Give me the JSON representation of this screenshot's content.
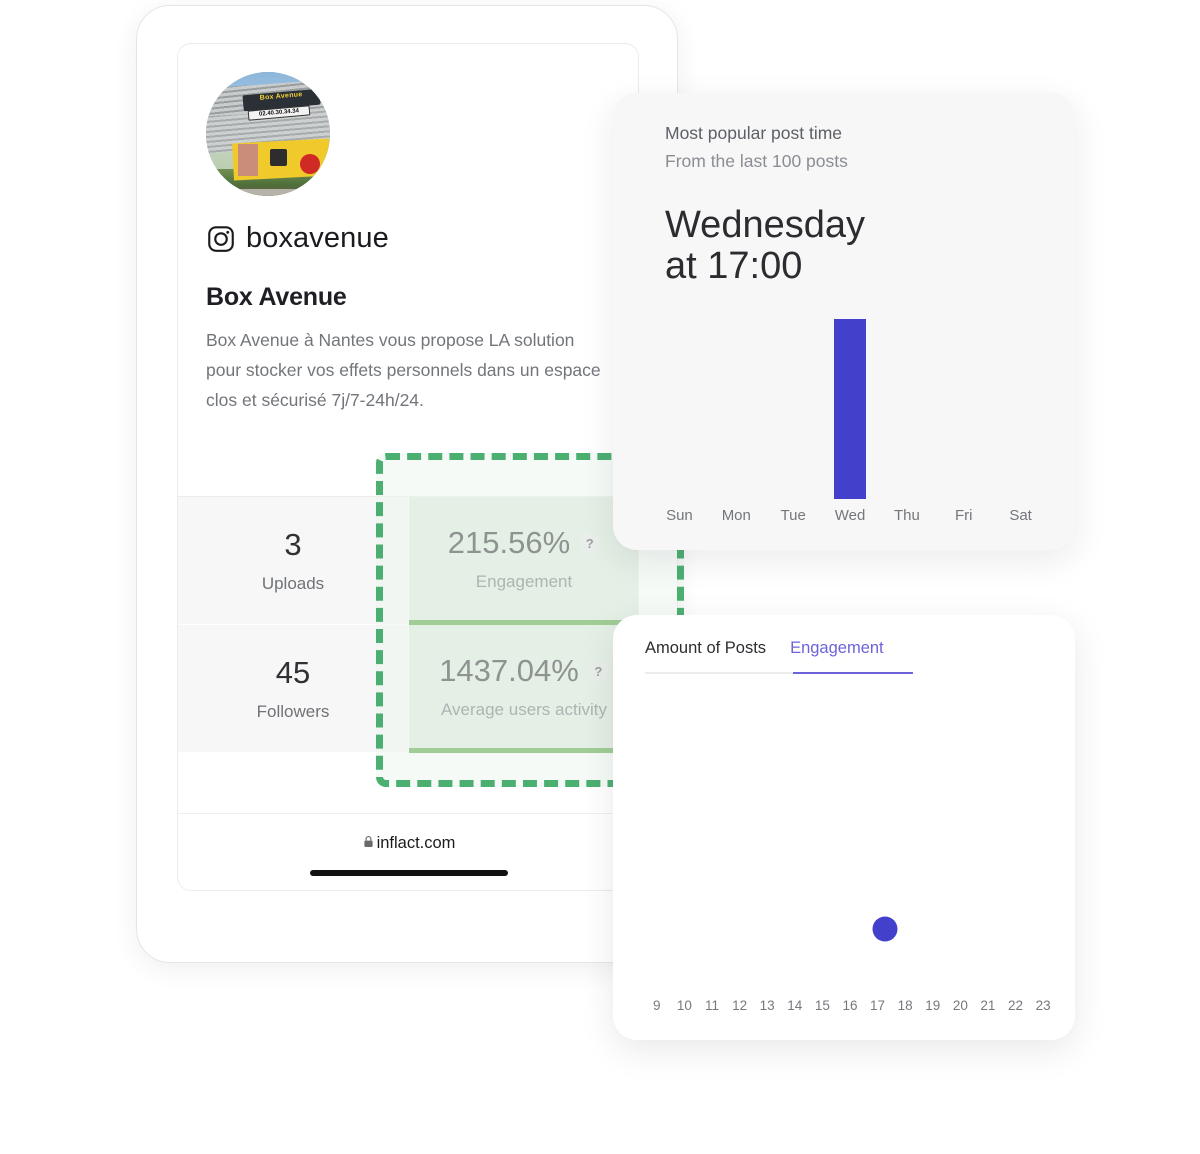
{
  "device": {
    "url": "inflact.com",
    "lock_icon": "lock-icon"
  },
  "profile": {
    "avatar_alt": "Box Avenue storefront photo",
    "platform_icon": "instagram-icon",
    "handle": "boxavenue",
    "full_name": "Box Avenue",
    "bio": "Box Avenue à Nantes vous propose LA solution pour stocker vos effets personnels dans un espace clos et sécurisé 7j/7-24h/24."
  },
  "stats": [
    {
      "value": "3",
      "label": "Uploads",
      "highlighted": false,
      "help": null
    },
    {
      "value": "215.56%",
      "label": "Engagement",
      "highlighted": true,
      "help": "?"
    },
    {
      "value": "45",
      "label": "Followers",
      "highlighted": false,
      "help": null
    },
    {
      "value": "1437.04%",
      "label": "Average users activity",
      "highlighted": true,
      "help": "?"
    }
  ],
  "device_tabs": {
    "items": [
      {
        "label": "Amount of Posts",
        "active": true
      },
      {
        "label": "Engagement",
        "active": false
      }
    ]
  },
  "post_time_card": {
    "title": "Most popular post time",
    "subtitle": "From the last 100 posts",
    "headline_line1": "Wednesday",
    "headline_line2": "at 17:00"
  },
  "engagement_card": {
    "tabs": [
      {
        "label": "Amount of Posts",
        "active": false
      },
      {
        "label": "Engagement",
        "active": true
      }
    ]
  },
  "colors": {
    "accent_purple": "#6c63d8",
    "bar_indigo": "#4340cc",
    "highlight_green": "#56a33c",
    "selection_green": "#4caf72",
    "highlight_bg": "#dde9dd"
  },
  "chart_data": [
    {
      "type": "bar",
      "title": "Most popular post time",
      "subtitle": "From the last 100 posts",
      "categories": [
        "Sun",
        "Mon",
        "Tue",
        "Wed",
        "Thu",
        "Fri",
        "Sat"
      ],
      "values": [
        0,
        0,
        0,
        100,
        0,
        0,
        0
      ],
      "xlabel": "",
      "ylabel": "",
      "ylim": [
        0,
        100
      ],
      "grid": false,
      "legend": "none",
      "series_color": "#4340cc"
    },
    {
      "type": "scatter",
      "title": "Engagement",
      "categories": [
        "9",
        "10",
        "11",
        "12",
        "13",
        "14",
        "15",
        "16",
        "17",
        "18",
        "19",
        "20",
        "21",
        "22",
        "23"
      ],
      "points": [
        {
          "x": "17",
          "y": 22
        }
      ],
      "xlabel": "",
      "ylabel": "",
      "ylim": [
        0,
        100
      ],
      "grid": false,
      "legend": "none",
      "series_color": "#4340cc"
    }
  ]
}
